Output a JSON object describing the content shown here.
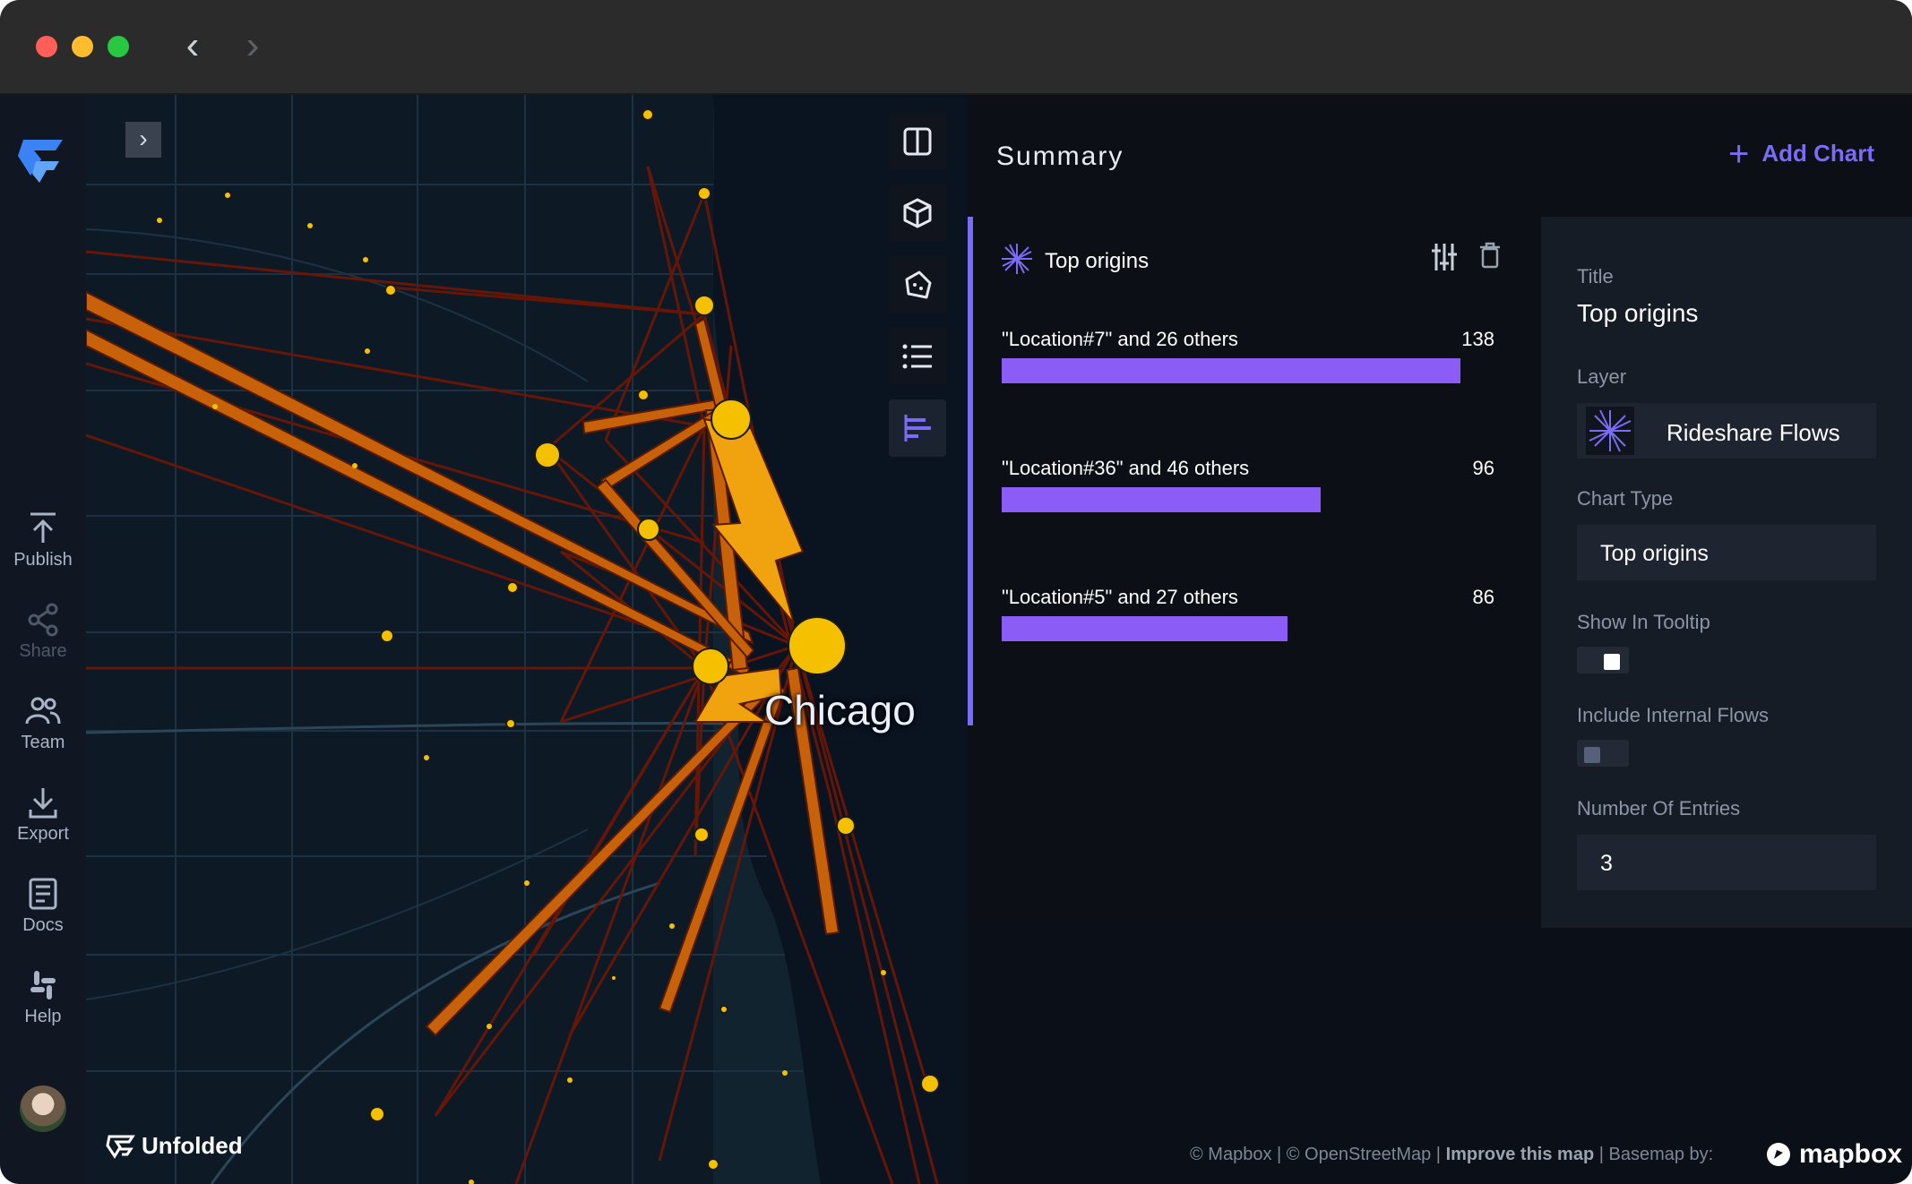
{
  "window": {
    "nav_back": "‹",
    "nav_forward": "›"
  },
  "sidebar": {
    "items": [
      {
        "label": "Publish",
        "icon": "publish-icon"
      },
      {
        "label": "Share",
        "icon": "share-icon"
      },
      {
        "label": "Team",
        "icon": "team-icon"
      },
      {
        "label": "Export",
        "icon": "export-icon"
      },
      {
        "label": "Docs",
        "icon": "docs-icon"
      },
      {
        "label": "Help",
        "icon": "slack-icon"
      }
    ]
  },
  "map": {
    "expand": "›",
    "city_label": "Chicago",
    "brand": "Unfolded",
    "tools": [
      "split-map-icon",
      "3d-cube-icon",
      "draw-polygon-icon",
      "layer-list-icon",
      "charts-icon"
    ]
  },
  "panel": {
    "title": "Summary",
    "add_chart": "Add Chart",
    "chart": {
      "title": "Top origins",
      "rows": [
        {
          "label": "\"Location#7\" and 26 others",
          "value": "138",
          "fraction": 1.0
        },
        {
          "label": "\"Location#36\" and 46 others",
          "value": "96",
          "fraction": 0.696
        },
        {
          "label": "\"Location#5\" and 27 others",
          "value": "86",
          "fraction": 0.623
        }
      ]
    },
    "settings": {
      "title_label": "Title",
      "title_value": "Top origins",
      "layer_label": "Layer",
      "layer_value": "Rideshare Flows",
      "chart_type_label": "Chart Type",
      "chart_type_value": "Top origins",
      "tooltip_label": "Show In Tooltip",
      "tooltip_on": true,
      "internal_label": "Include Internal Flows",
      "internal_on": false,
      "entries_label": "Number Of Entries",
      "entries_value": "3"
    }
  },
  "attribution": {
    "mapbox": "© Mapbox",
    "sep1": " | ",
    "osm": "© OpenStreetMap",
    "sep2": " | ",
    "improve": "Improve this map",
    "sep3": " | ",
    "basemap": "Basemap by:",
    "logo": "mapbox"
  },
  "colors": {
    "accent": "#7b6cf6",
    "bar": "#8b5cf6",
    "flow": "#e08a0c",
    "node": "#f5c000"
  }
}
